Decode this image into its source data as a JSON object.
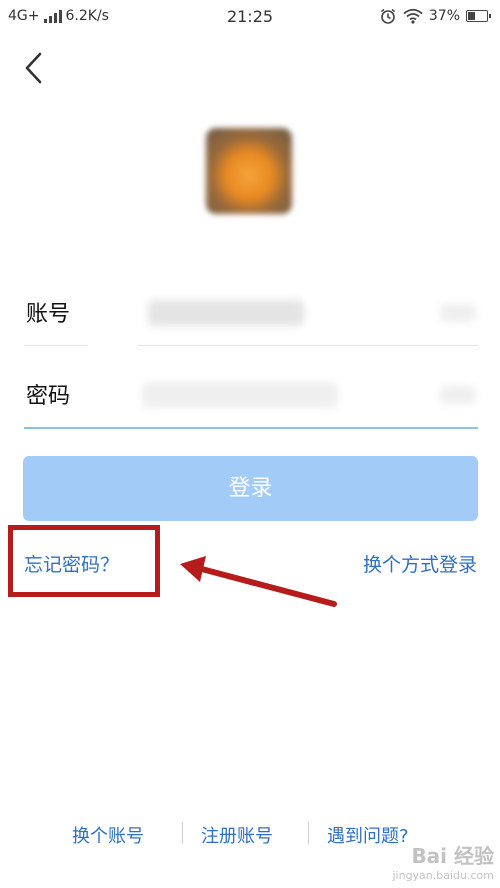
{
  "status_bar": {
    "network": "4G+",
    "speed": "6.2K/s",
    "time": "21:25",
    "battery_label": "37%",
    "battery_level": 0.37
  },
  "form": {
    "account_label": "账号",
    "password_label": "密码",
    "login_button": "登录"
  },
  "links": {
    "forgot_password": "忘记密码？",
    "switch_login_method": "换个方式登录"
  },
  "footer": {
    "switch_account": "换个账号",
    "register": "注册账号",
    "help": "遇到问题?"
  },
  "watermark": {
    "brand": "Bai 经验",
    "url": "jingyan.baidu.com"
  },
  "colors": {
    "link_blue": "#2f6fc6",
    "login_button_bg": "#a2cbf8",
    "annotation_red": "#b71c1c"
  }
}
